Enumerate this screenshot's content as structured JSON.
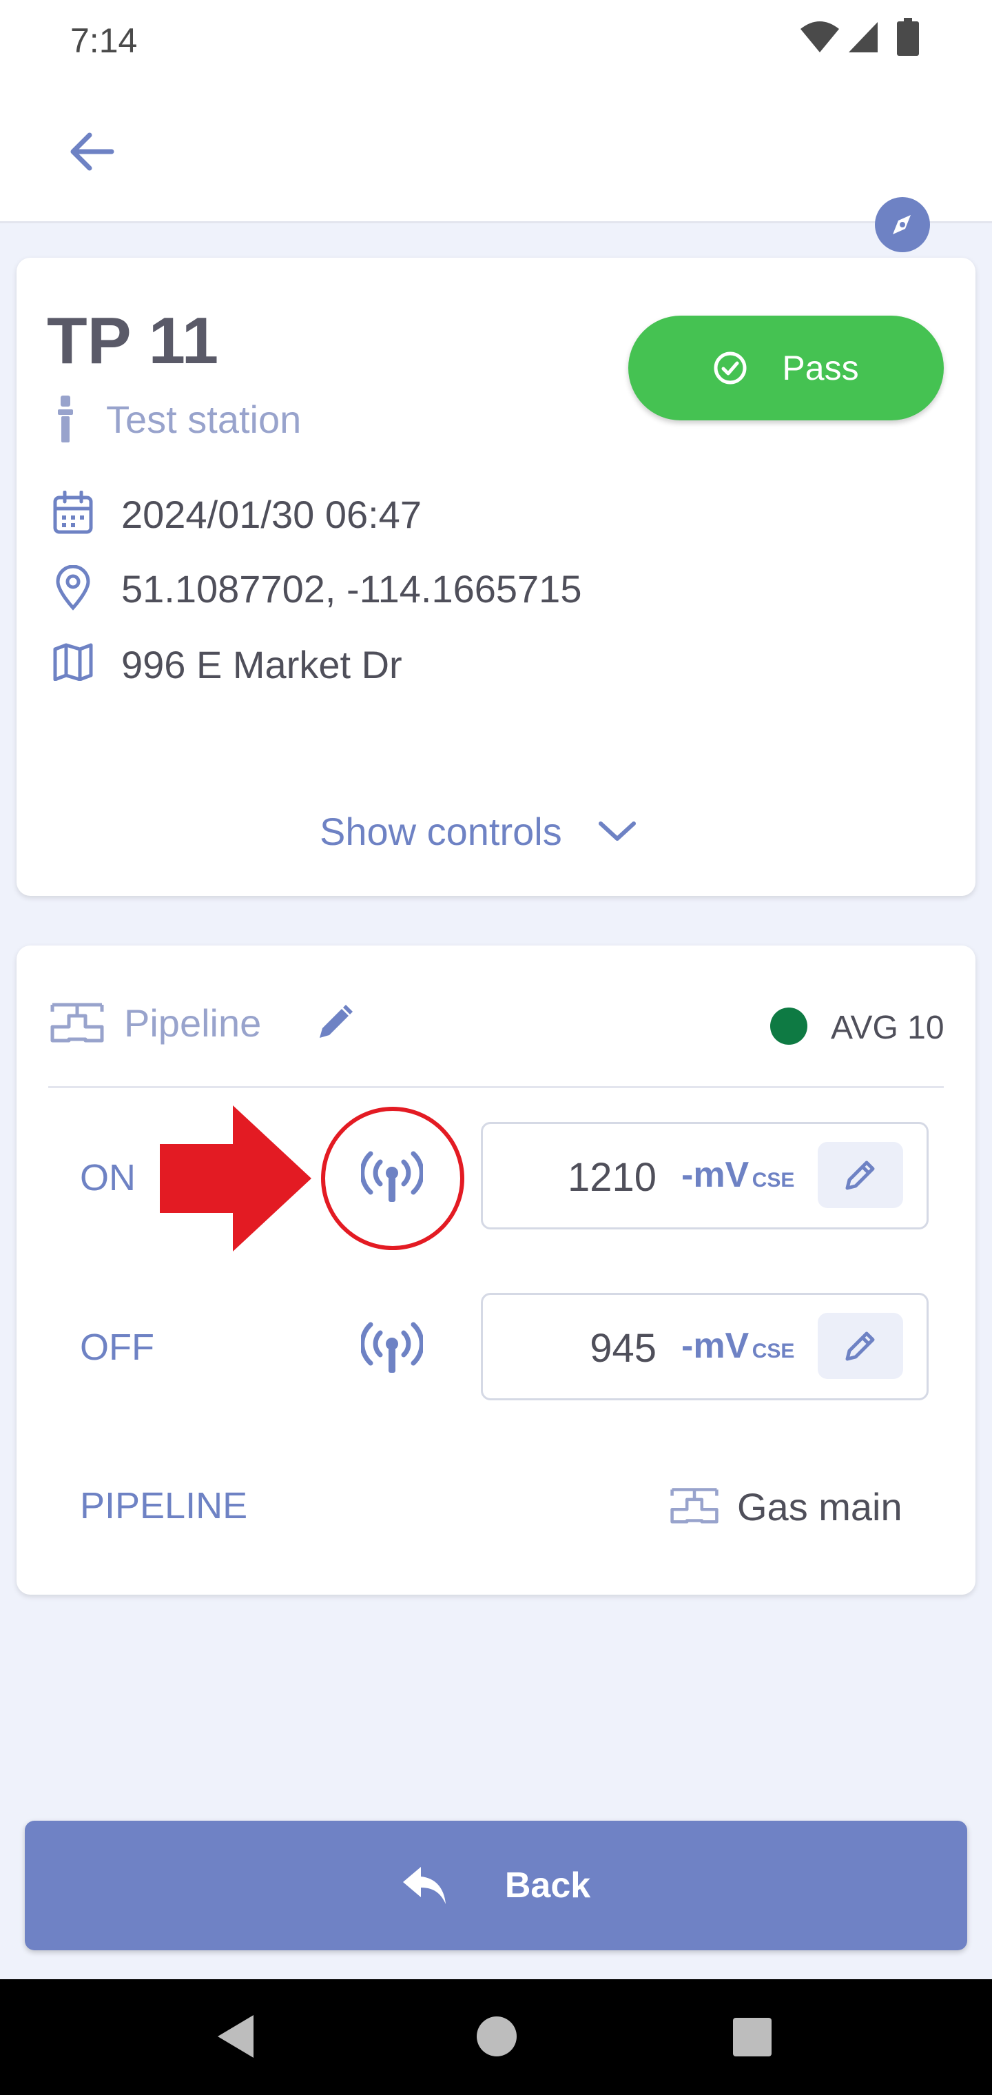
{
  "status_bar": {
    "time": "7:14"
  },
  "header": {
    "back_icon": "arrow-left-icon",
    "compass_icon": "compass-icon"
  },
  "station": {
    "title": "TP 11",
    "type_label": "Test station",
    "status_label": "Pass",
    "status_color": "#45c252",
    "datetime": "2024/01/30 06:47",
    "coordinates": "51.1087702, -114.1665715",
    "address": "996 E Market Dr",
    "show_controls_label": "Show controls"
  },
  "measurement": {
    "section_label": "Pipeline",
    "avg_label": "AVG 10",
    "avg_dot_color": "#0e7a43",
    "rows": [
      {
        "label": "ON",
        "value": "1210",
        "unit": "-mV",
        "unit_sub": "CSE"
      },
      {
        "label": "OFF",
        "value": "945",
        "unit": "-mV",
        "unit_sub": "CSE"
      }
    ],
    "pipeline_key": "PIPELINE",
    "pipeline_value": "Gas main"
  },
  "footer": {
    "back_label": "Back"
  },
  "annotation": {
    "color": "#e31b23"
  }
}
